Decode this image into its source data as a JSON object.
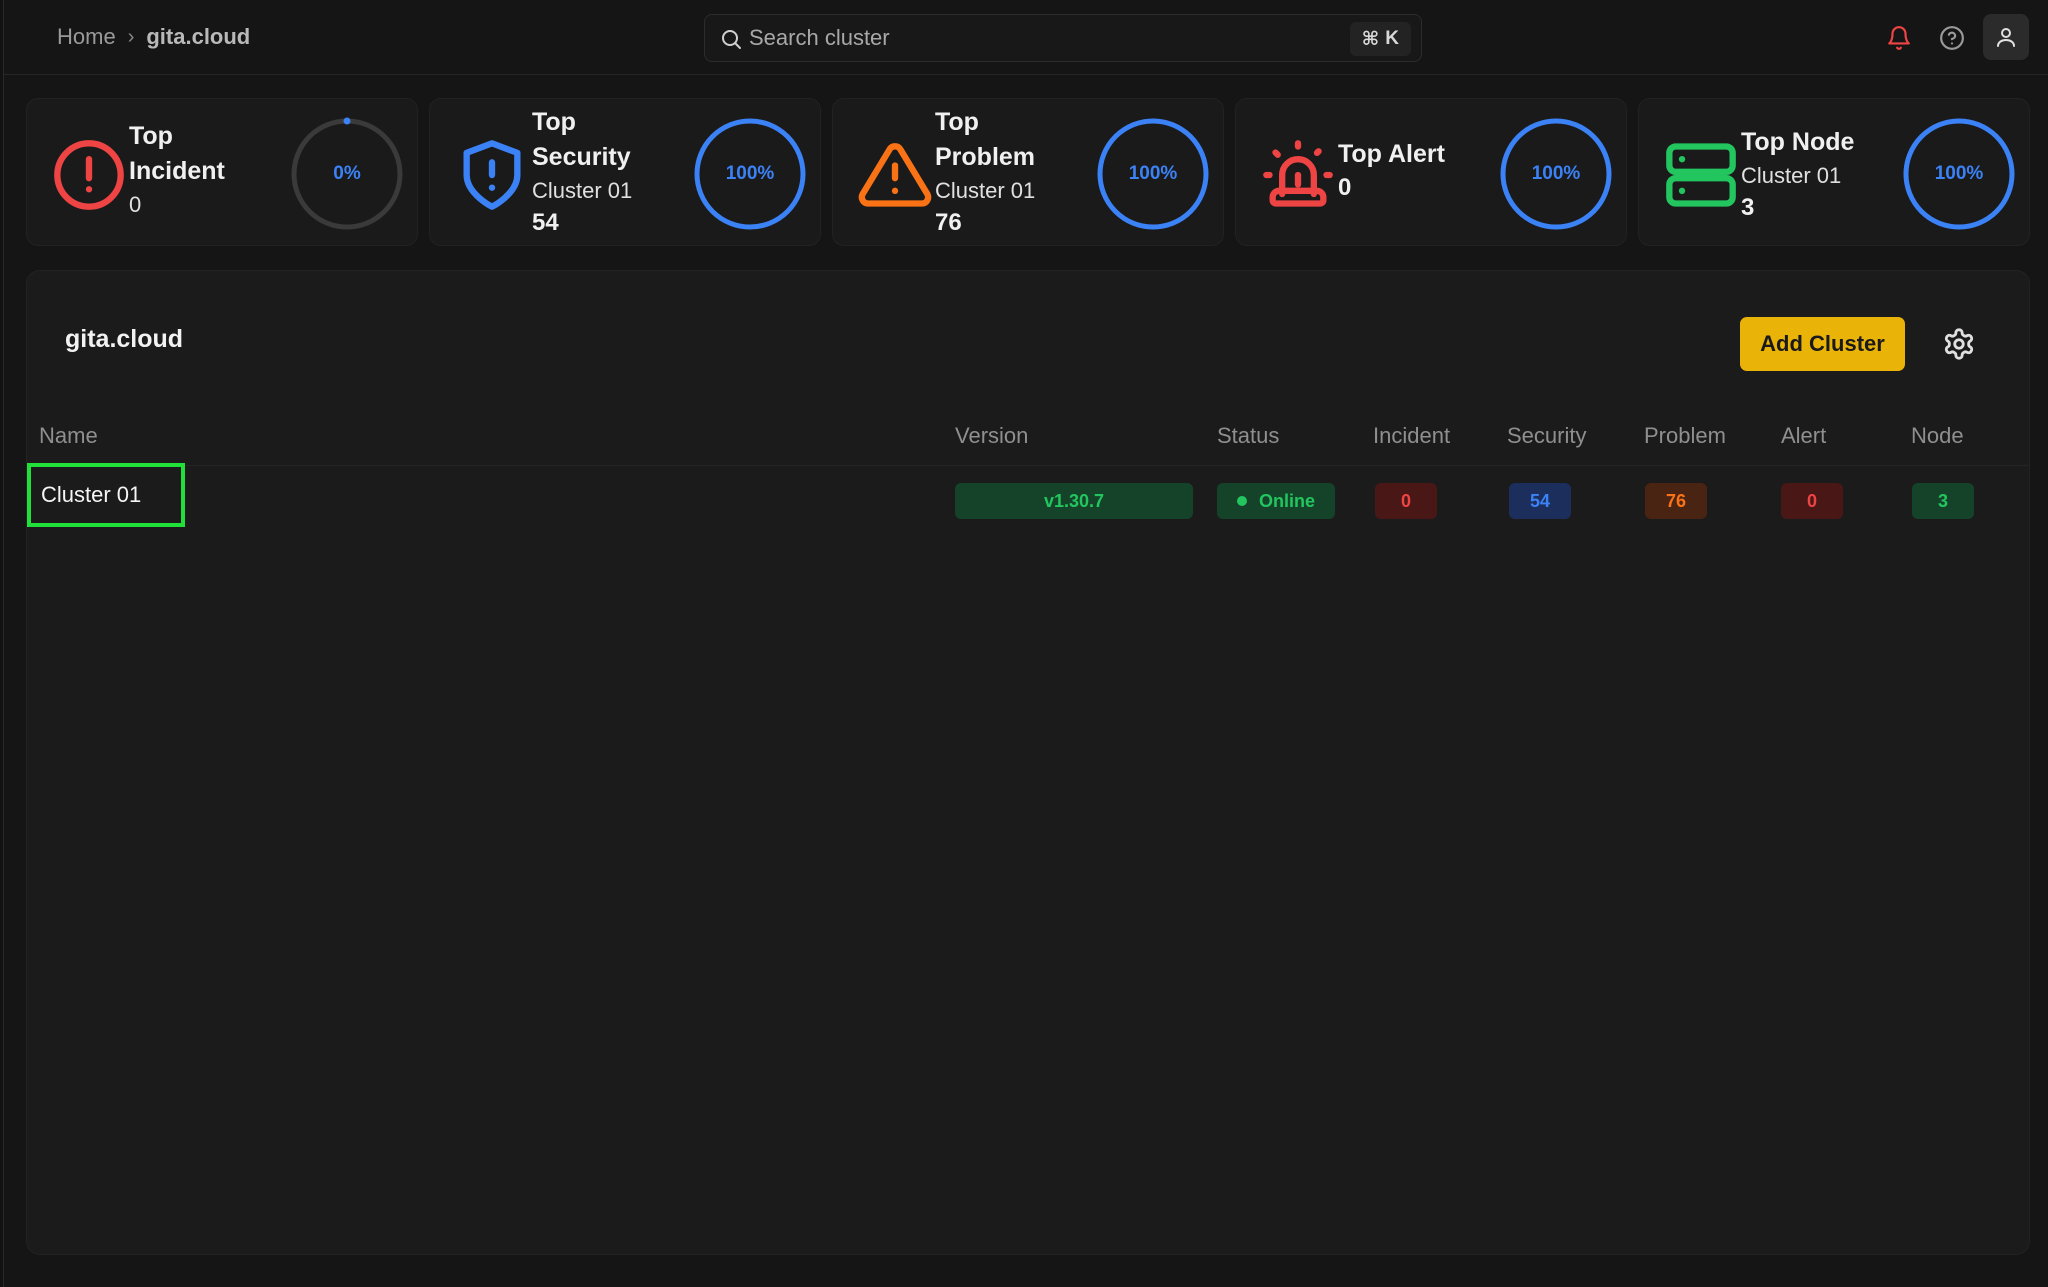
{
  "breadcrumb": {
    "home": "Home",
    "separator": "›",
    "current": "gita.cloud"
  },
  "search": {
    "placeholder": "Search cluster",
    "shortcut_symbol": "⌘",
    "shortcut_key": "K"
  },
  "colors": {
    "accent": "#eab308",
    "red": "#ef4444",
    "blue": "#3b82f6",
    "orange": "#f97316",
    "green": "#22c55e",
    "highlight": "#22e03a"
  },
  "cards": [
    {
      "title_line1": "Top",
      "title_line2": "Incident",
      "value": "0",
      "percent_label": "0%",
      "percent": 0,
      "icon": "alert-circle-icon",
      "color": "#ef4444"
    },
    {
      "title_line1": "Top",
      "title_line2": "Security",
      "subtitle": "Cluster 01",
      "value": "54",
      "percent_label": "100%",
      "percent": 100,
      "icon": "shield-alert-icon",
      "color": "#3b82f6"
    },
    {
      "title_line1": "Top",
      "title_line2": "Problem",
      "subtitle": "Cluster 01",
      "value": "76",
      "percent_label": "100%",
      "percent": 100,
      "icon": "warning-triangle-icon",
      "color": "#f97316"
    },
    {
      "title": "Top Alert",
      "value": "0",
      "percent_label": "100%",
      "percent": 100,
      "icon": "siren-icon",
      "color": "#ef4444"
    },
    {
      "title": "Top Node",
      "subtitle": "Cluster 01",
      "value": "3",
      "percent_label": "100%",
      "percent": 100,
      "icon": "server-icon",
      "color": "#22c55e"
    }
  ],
  "panel": {
    "title": "gita.cloud",
    "add_button": "Add Cluster",
    "columns": [
      "Name",
      "Version",
      "Status",
      "Incident",
      "Security",
      "Problem",
      "Alert",
      "Node"
    ],
    "rows": [
      {
        "name": "Cluster 01",
        "version": "v1.30.7",
        "status": "Online",
        "incident": "0",
        "security": "54",
        "problem": "76",
        "alert": "0",
        "node": "3"
      }
    ]
  }
}
